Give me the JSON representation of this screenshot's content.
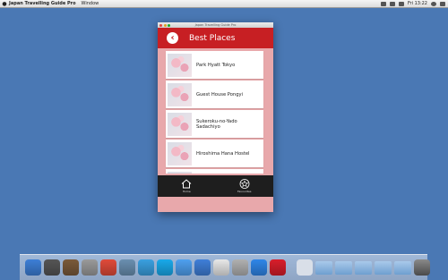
{
  "menubar": {
    "app_name": "Japan Travelling Guide Pro",
    "menu_window": "Window",
    "clock": "Fri 13:22"
  },
  "window": {
    "title": "Japan Travelling Guide Pro"
  },
  "header": {
    "back_glyph": "‹",
    "title": "Best Places"
  },
  "places": [
    {
      "name": "Park Hyatt Tokyo"
    },
    {
      "name": "Guest House Pongyi"
    },
    {
      "name": "Sukeroku-no-Yado Sadachiyo"
    },
    {
      "name": "Hiroshima Hana Hostel"
    }
  ],
  "tabs": [
    {
      "label": "Home",
      "icon": "home-icon"
    },
    {
      "label": "Favourites",
      "icon": "star-icon"
    }
  ],
  "dock": {
    "icons": [
      "finder-icon",
      "dashboard-icon",
      "mission-control-icon",
      "system-preferences-icon",
      "chrome-icon",
      "preview-icon",
      "safari-icon",
      "skype-icon",
      "messages-icon",
      "itunes-icon",
      "textedit-icon",
      "installer-icon",
      "app-store-icon",
      "japan-guide-icon"
    ],
    "colors": [
      "#3d7fd6",
      "#555555",
      "#7a5a3a",
      "#9a9a9a",
      "#e04b3a",
      "#6a8fb0",
      "#3aa0e0",
      "#19a9ea",
      "#4fa0ef",
      "#3f7fd8",
      "#e8e8e8",
      "#b0b0b0",
      "#2f86e8",
      "#d81e2b"
    ]
  }
}
